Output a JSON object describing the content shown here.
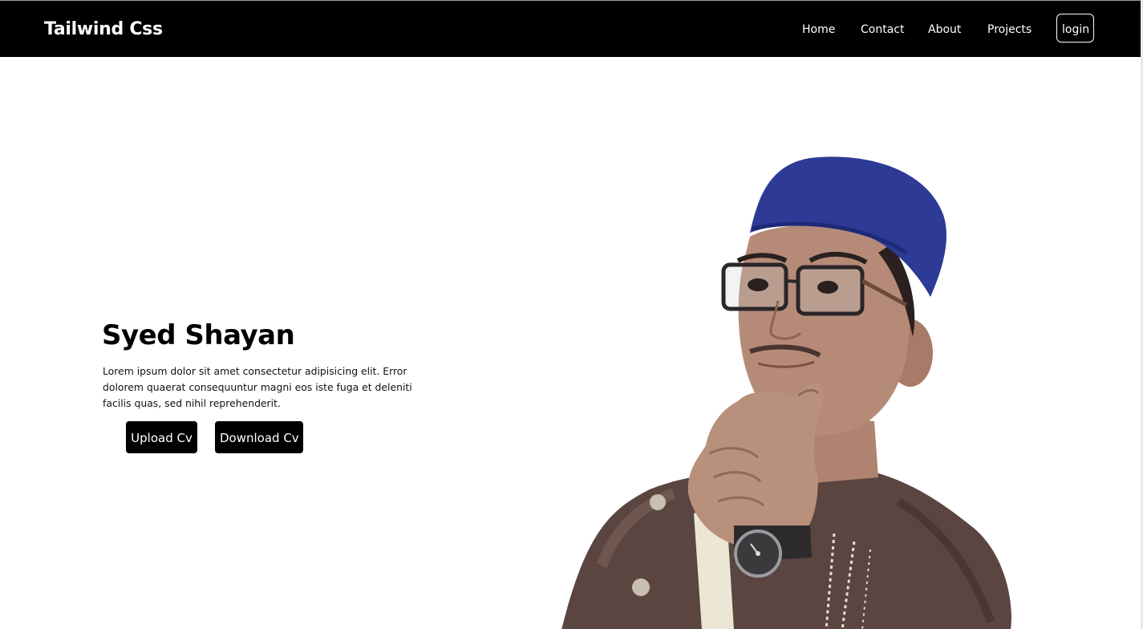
{
  "navbar": {
    "brand": "Tailwind Css",
    "links": [
      "Home",
      "Contact",
      "About",
      "Projects"
    ],
    "login_label": "login"
  },
  "hero": {
    "title": "Syed Shayan",
    "description": "Lorem ipsum dolor sit amet consectetur adipisicing elit. Error dolorem quaerat consequuntur magni eos iste fuga et deleniti facilis quas, sed nihil reprehenderit.",
    "upload_label": "Upload Cv",
    "download_label": "Download Cv"
  },
  "colors": {
    "navbar_bg": "#000000",
    "button_bg": "#000000",
    "cap": "#2d3a96",
    "shirt": "#5a4540"
  },
  "icons": {
    "portrait": "person-photo"
  }
}
